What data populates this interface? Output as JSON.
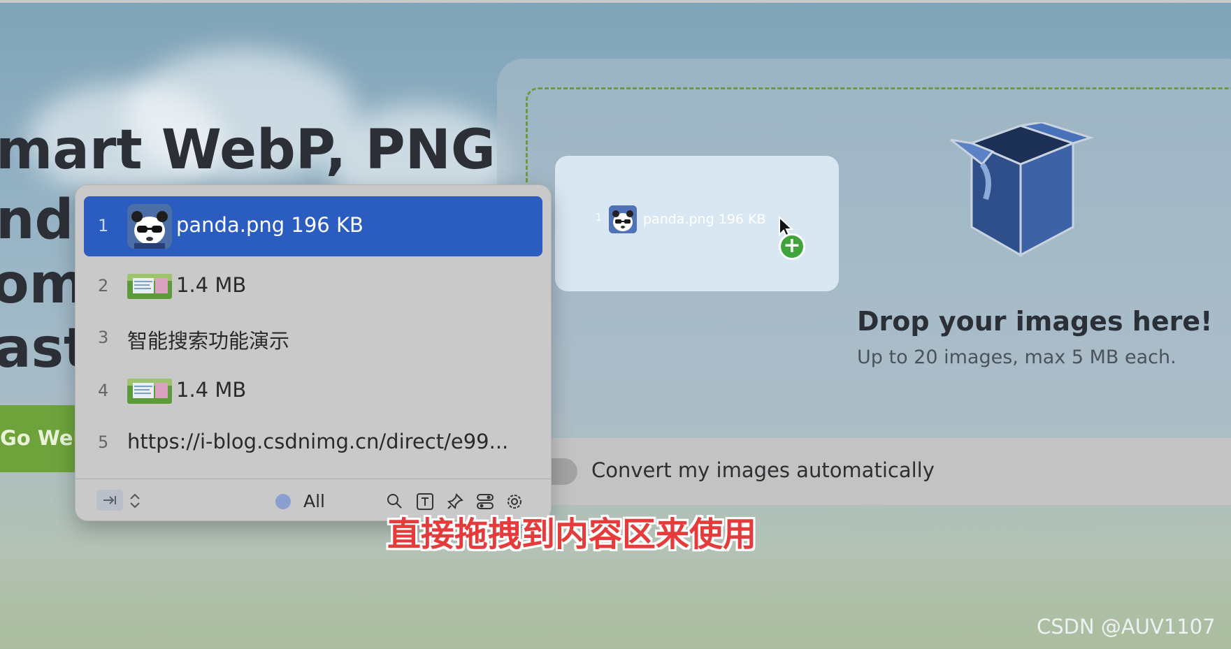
{
  "hero": {
    "line1": "mart WebP, PNG",
    "line2": "nd",
    "line3": "om",
    "line4": "ast",
    "button_label": "Go Web"
  },
  "dropzone": {
    "title": "Drop your images here!",
    "subtitle": "Up to 20 images, max 5 MB each.",
    "convert_label": "Convert my images automatically",
    "convert_enabled": false
  },
  "drag_preview": {
    "index": "1",
    "text": "panda.png  196 KB"
  },
  "clipboard": {
    "items": [
      {
        "index": "1",
        "thumb": "panda",
        "text": "panda.png  196 KB",
        "selected": true
      },
      {
        "index": "2",
        "thumb": "screenshot",
        "text": "1.4 MB",
        "selected": false
      },
      {
        "index": "3",
        "thumb": "none",
        "text": "智能搜索功能演示",
        "selected": false
      },
      {
        "index": "4",
        "thumb": "screenshot",
        "text": "1.4 MB",
        "selected": false
      },
      {
        "index": "5",
        "thumb": "none",
        "text": "https://i-blog.csdnimg.cn/direct/e99...",
        "selected": false
      }
    ],
    "filter_label": "All",
    "footer_icons": [
      "tab-icon",
      "sort-icon",
      "filter-dot-icon",
      "search-icon",
      "text-icon",
      "pin-icon",
      "toggle-icon",
      "settings-icon"
    ]
  },
  "caption": "直接拖拽到内容区来使用",
  "watermark": "CSDN @AUV1107",
  "colors": {
    "accent_selected": "#2b5cbf",
    "caption_red": "#e53b3b",
    "dash_green": "#6e9a3c",
    "button_green": "#6ea33c"
  }
}
